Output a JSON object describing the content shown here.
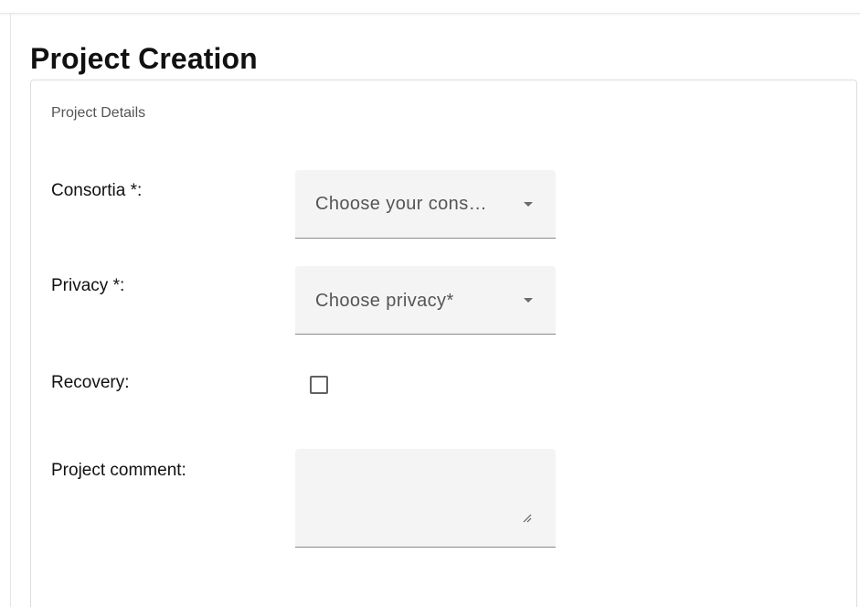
{
  "page": {
    "title": "Project Creation"
  },
  "section": {
    "title": "Project Details"
  },
  "fields": {
    "consortia": {
      "label": "Consortia *:",
      "placeholder": "Choose your cons…"
    },
    "privacy": {
      "label": "Privacy *:",
      "placeholder": "Choose privacy*"
    },
    "recovery": {
      "label": "Recovery:",
      "checked": false
    },
    "comment": {
      "label": "Project comment:",
      "value": ""
    }
  },
  "icons": {
    "dropdown": "caret-down-icon",
    "resize": "resize-handle-icon"
  },
  "colors": {
    "field_background": "#f4f4f4",
    "field_underline": "#8a8a8a",
    "title_text": "#111111",
    "section_text": "#555555"
  }
}
